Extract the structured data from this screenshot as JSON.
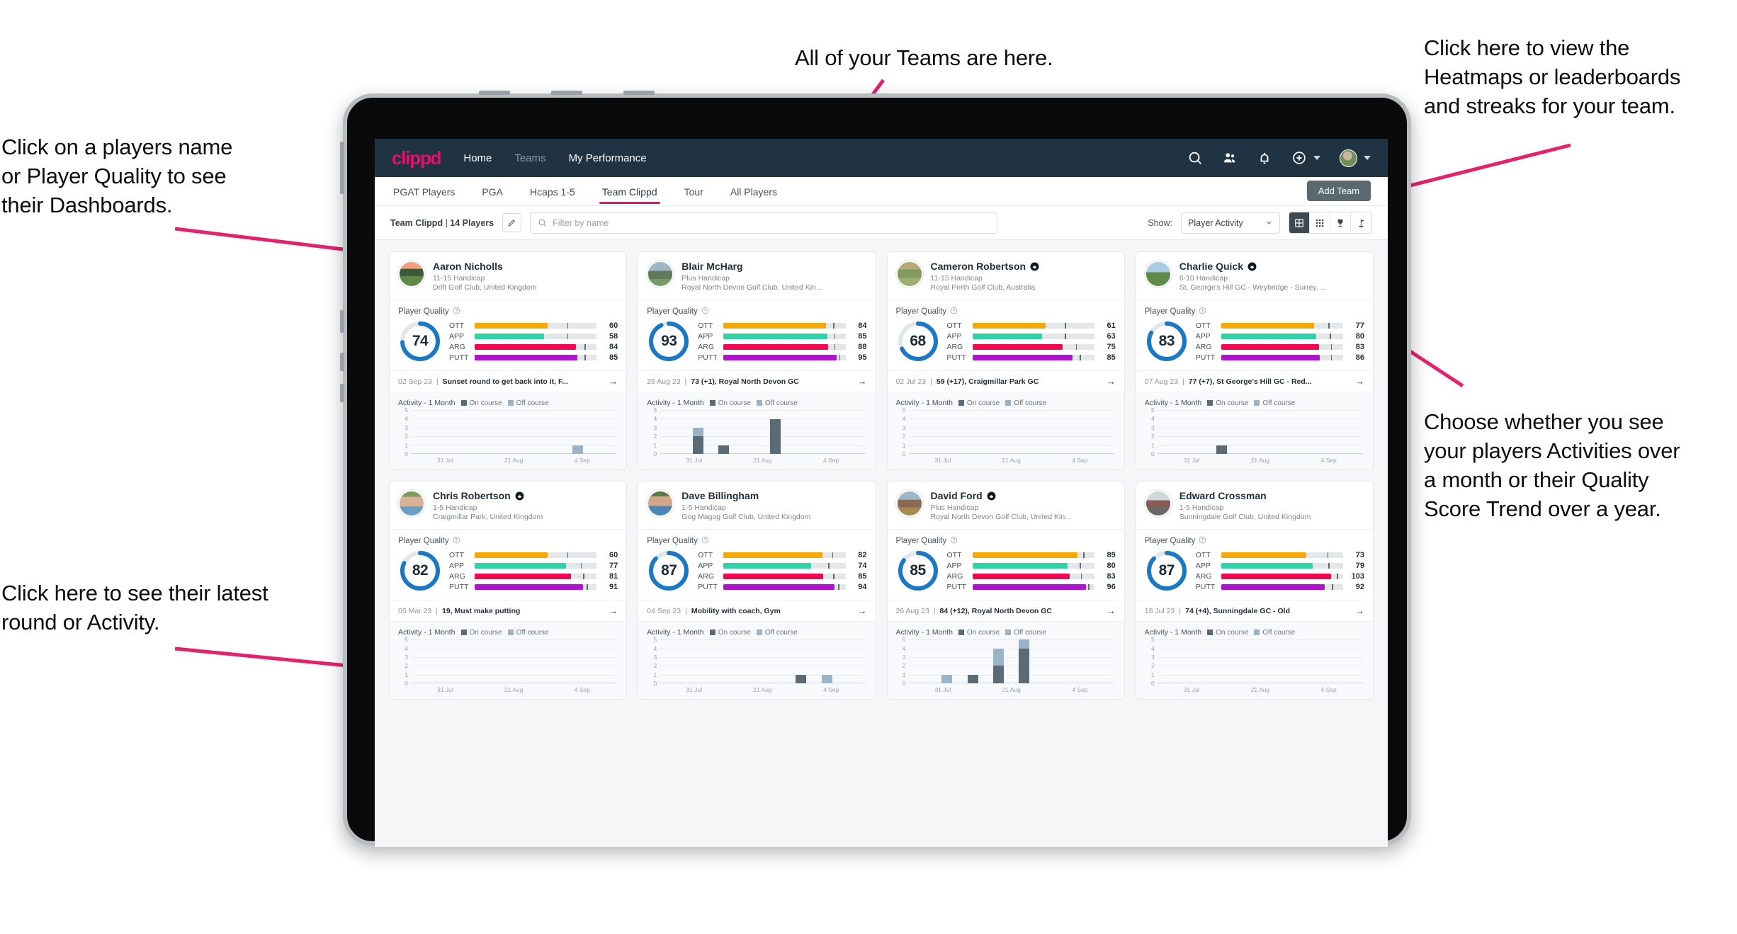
{
  "annotations": [
    {
      "id": "players-name",
      "text": "Click on a players name\nor Player Quality to see\ntheir Dashboards."
    },
    {
      "id": "teams-here",
      "text": "All of your Teams are here."
    },
    {
      "id": "heatmaps",
      "text": "Click here to view the\nHeatmaps or leaderboards\nand streaks for your team."
    },
    {
      "id": "activity-toggle",
      "text": "Choose whether you see\nyour players Activities over\na month or their Quality\nScore Trend over a year."
    },
    {
      "id": "latest-round",
      "text": "Click here to see their latest\nround or Activity."
    }
  ],
  "app": {
    "logo": "clippd",
    "nav": [
      {
        "label": "Home",
        "active": true
      },
      {
        "label": "Teams",
        "active": false
      },
      {
        "label": "My Performance",
        "active": false
      }
    ],
    "icons": [
      "search-icon",
      "people-icon",
      "bell-icon",
      "plus-circle-icon",
      "avatar"
    ],
    "tabs": [
      {
        "label": "PGAT Players",
        "active": false
      },
      {
        "label": "PGA",
        "active": false
      },
      {
        "label": "Hcaps 1-5",
        "active": false
      },
      {
        "label": "Team Clippd",
        "active": true
      },
      {
        "label": "Tour",
        "active": false
      },
      {
        "label": "All Players",
        "active": false
      }
    ],
    "add_team_label": "Add Team",
    "filter": {
      "team_name": "Team Clippd",
      "team_count": "14 Players",
      "separator": " | ",
      "search_placeholder": "Filter by name",
      "search_value": "",
      "show_label": "Show:",
      "show_value": "Player Activity",
      "show_options": [
        "Player Activity",
        "Quality Score Trend"
      ],
      "view_buttons": [
        {
          "name": "grid-view-icon",
          "active": true
        },
        {
          "name": "dense-grid-view-icon",
          "active": false
        },
        {
          "name": "trophy-leaderboard-icon",
          "active": false
        },
        {
          "name": "flag-heatmap-icon",
          "active": false
        }
      ]
    }
  },
  "card_labels": {
    "player_quality": "Player Quality",
    "activity_title": "Activity - 1 Month",
    "legend_on": "On course",
    "legend_off": "Off course",
    "x_labels": [
      "31 Jul",
      "21 Aug",
      "4 Sep"
    ],
    "y_labels": [
      "5",
      "4",
      "3",
      "2",
      "1",
      "0"
    ]
  },
  "colors": {
    "brand_pink": "#ec0d6e",
    "header_navy": "#1f3342",
    "ring_blue": "#1a79c6",
    "ott": "#f5a800",
    "app": "#2ed4a8",
    "arg": "#f5054f",
    "putt": "#b112cf",
    "on_course": "#5b6b76",
    "off_course": "#9bb3c6",
    "annotation_arrow": "#e6206b"
  },
  "players": [
    {
      "name": "Aaron Nicholls",
      "verified": false,
      "handicap": "11-15 Handicap",
      "club": "Drift Golf Club, United Kingdom",
      "avatar_css": "linear-gradient(180deg,#f2a07a 0 28%,#3a5a3a 29% 58%,#5e8a46 59% 100%)",
      "quality": 74,
      "metrics": [
        {
          "label": "OTT",
          "value": 60,
          "fill_pct": 60,
          "tick_pct": 76
        },
        {
          "label": "APP",
          "value": 58,
          "fill_pct": 57,
          "tick_pct": 76
        },
        {
          "label": "ARG",
          "value": 84,
          "fill_pct": 83,
          "tick_pct": 90
        },
        {
          "label": "PUTT",
          "value": 85,
          "fill_pct": 84,
          "tick_pct": 90
        }
      ],
      "latest_date": "02 Sep 23",
      "latest_text": "Sunset round to get back into it, F...",
      "activity": [
        {
          "on": 0,
          "off": 0
        },
        {
          "on": 0,
          "off": 0
        },
        {
          "on": 0,
          "off": 0
        },
        {
          "on": 0,
          "off": 0
        },
        {
          "on": 0,
          "off": 0
        },
        {
          "on": 0,
          "off": 0
        },
        {
          "on": 0,
          "off": 1
        },
        {
          "on": 0,
          "off": 0
        }
      ]
    },
    {
      "name": "Blair McHarg",
      "verified": false,
      "handicap": "Plus Handicap",
      "club": "Royal North Devon Golf Club, United Kin...",
      "avatar_css": "linear-gradient(180deg,#9fb6c4 0 36%,#5d7a5a 37% 70%,#7a9a6a 71% 100%)",
      "quality": 93,
      "metrics": [
        {
          "label": "OTT",
          "value": 84,
          "fill_pct": 84,
          "tick_pct": 90
        },
        {
          "label": "APP",
          "value": 85,
          "fill_pct": 85,
          "tick_pct": 91
        },
        {
          "label": "ARG",
          "value": 88,
          "fill_pct": 86,
          "tick_pct": 91
        },
        {
          "label": "PUTT",
          "value": 95,
          "fill_pct": 93,
          "tick_pct": 95
        }
      ],
      "latest_date": "26 Aug 23",
      "latest_text": "73 (+1), Royal North Devon GC",
      "activity": [
        {
          "on": 0,
          "off": 0
        },
        {
          "on": 2,
          "off": 1
        },
        {
          "on": 1,
          "off": 0
        },
        {
          "on": 0,
          "off": 0
        },
        {
          "on": 4,
          "off": 0
        },
        {
          "on": 0,
          "off": 0
        },
        {
          "on": 0,
          "off": 0
        },
        {
          "on": 0,
          "off": 0
        }
      ]
    },
    {
      "name": "Cameron Robertson",
      "verified": true,
      "handicap": "11-15 Handicap",
      "club": "Royal Perth Golf Club, Australia",
      "avatar_css": "linear-gradient(180deg,#b9a878 0 30%,#7f9a5c 31% 64%,#9cae74 65% 100%)",
      "quality": 68,
      "metrics": [
        {
          "label": "OTT",
          "value": 61,
          "fill_pct": 60,
          "tick_pct": 76
        },
        {
          "label": "APP",
          "value": 63,
          "fill_pct": 57,
          "tick_pct": 76
        },
        {
          "label": "ARG",
          "value": 75,
          "fill_pct": 74,
          "tick_pct": 85
        },
        {
          "label": "PUTT",
          "value": 85,
          "fill_pct": 82,
          "tick_pct": 88
        }
      ],
      "latest_date": "02 Jul 23",
      "latest_text": "59 (+17), Craigmillar Park GC",
      "activity": [
        {
          "on": 0,
          "off": 0
        },
        {
          "on": 0,
          "off": 0
        },
        {
          "on": 0,
          "off": 0
        },
        {
          "on": 0,
          "off": 0
        },
        {
          "on": 0,
          "off": 0
        },
        {
          "on": 0,
          "off": 0
        },
        {
          "on": 0,
          "off": 0
        },
        {
          "on": 0,
          "off": 0
        }
      ]
    },
    {
      "name": "Charlie Quick",
      "verified": true,
      "handicap": "6-10 Handicap",
      "club": "St. George's Hill GC - Weybridge - Surrey, ...",
      "avatar_css": "linear-gradient(180deg,#a9cbe3 0 42%,#5e8a46 43% 100%)",
      "quality": 83,
      "metrics": [
        {
          "label": "OTT",
          "value": 77,
          "fill_pct": 76,
          "tick_pct": 88
        },
        {
          "label": "APP",
          "value": 80,
          "fill_pct": 78,
          "tick_pct": 89
        },
        {
          "label": "ARG",
          "value": 83,
          "fill_pct": 80,
          "tick_pct": 90
        },
        {
          "label": "PUTT",
          "value": 86,
          "fill_pct": 81,
          "tick_pct": 90
        }
      ],
      "latest_date": "07 Aug 23",
      "latest_text": "77 (+7), St George's Hill GC - Red...",
      "activity": [
        {
          "on": 0,
          "off": 0
        },
        {
          "on": 0,
          "off": 0
        },
        {
          "on": 1,
          "off": 0
        },
        {
          "on": 0,
          "off": 0
        },
        {
          "on": 0,
          "off": 0
        },
        {
          "on": 0,
          "off": 0
        },
        {
          "on": 0,
          "off": 0
        },
        {
          "on": 0,
          "off": 0
        }
      ]
    },
    {
      "name": "Chris Robertson",
      "verified": true,
      "handicap": "1-5 Handicap",
      "club": "Craigmillar Park, United Kingdom",
      "avatar_css": "linear-gradient(180deg,#7f9a5c 0 22%,#d8b295 23% 62%,#6aa0c8 63% 100%)",
      "quality": 82,
      "metrics": [
        {
          "label": "OTT",
          "value": 60,
          "fill_pct": 60,
          "tick_pct": 76
        },
        {
          "label": "APP",
          "value": 77,
          "fill_pct": 75,
          "tick_pct": 87
        },
        {
          "label": "ARG",
          "value": 81,
          "fill_pct": 79,
          "tick_pct": 89
        },
        {
          "label": "PUTT",
          "value": 91,
          "fill_pct": 89,
          "tick_pct": 92
        }
      ],
      "latest_date": "05 Mar 23",
      "latest_text": "19, Must make putting",
      "activity": [
        {
          "on": 0,
          "off": 0
        },
        {
          "on": 0,
          "off": 0
        },
        {
          "on": 0,
          "off": 0
        },
        {
          "on": 0,
          "off": 0
        },
        {
          "on": 0,
          "off": 0
        },
        {
          "on": 0,
          "off": 0
        },
        {
          "on": 0,
          "off": 0
        },
        {
          "on": 0,
          "off": 0
        }
      ]
    },
    {
      "name": "Dave Billingham",
      "verified": false,
      "handicap": "1-5 Handicap",
      "club": "Gog Magog Golf Club, United Kingdom",
      "avatar_css": "linear-gradient(180deg,#5e7a4a 0 20%,#d2a686 21% 60%,#4b84b5 61% 100%)",
      "quality": 87,
      "metrics": [
        {
          "label": "OTT",
          "value": 82,
          "fill_pct": 81,
          "tick_pct": 89
        },
        {
          "label": "APP",
          "value": 74,
          "fill_pct": 72,
          "tick_pct": 86
        },
        {
          "label": "ARG",
          "value": 85,
          "fill_pct": 82,
          "tick_pct": 90
        },
        {
          "label": "PUTT",
          "value": 94,
          "fill_pct": 91,
          "tick_pct": 94
        }
      ],
      "latest_date": "04 Sep 23",
      "latest_text": "Mobility with coach, Gym",
      "activity": [
        {
          "on": 0,
          "off": 0
        },
        {
          "on": 0,
          "off": 0
        },
        {
          "on": 0,
          "off": 0
        },
        {
          "on": 0,
          "off": 0
        },
        {
          "on": 0,
          "off": 0
        },
        {
          "on": 1,
          "off": 0
        },
        {
          "on": 0,
          "off": 1
        },
        {
          "on": 0,
          "off": 0
        }
      ]
    },
    {
      "name": "David Ford",
      "verified": true,
      "handicap": "Plus Handicap",
      "club": "Royal North Devon Golf Club, United Kin...",
      "avatar_css": "linear-gradient(180deg,#9db7c9 0 34%,#8a6a52 35% 66%,#a8894f 67% 100%)",
      "quality": 85,
      "metrics": [
        {
          "label": "OTT",
          "value": 89,
          "fill_pct": 86,
          "tick_pct": 91
        },
        {
          "label": "APP",
          "value": 80,
          "fill_pct": 78,
          "tick_pct": 88
        },
        {
          "label": "ARG",
          "value": 83,
          "fill_pct": 80,
          "tick_pct": 89
        },
        {
          "label": "PUTT",
          "value": 96,
          "fill_pct": 93,
          "tick_pct": 95
        }
      ],
      "latest_date": "26 Aug 23",
      "latest_text": "84 (+12), Royal North Devon GC",
      "activity": [
        {
          "on": 0,
          "off": 0
        },
        {
          "on": 0,
          "off": 1
        },
        {
          "on": 1,
          "off": 0
        },
        {
          "on": 2,
          "off": 2
        },
        {
          "on": 4,
          "off": 1
        },
        {
          "on": 0,
          "off": 0
        },
        {
          "on": 0,
          "off": 0
        },
        {
          "on": 0,
          "off": 0
        }
      ]
    },
    {
      "name": "Edward Crossman",
      "verified": false,
      "handicap": "1-5 Handicap",
      "club": "Sunningdale Golf Club, United Kingdom",
      "avatar_css": "linear-gradient(180deg,#cfd6da 0 36%,#8c5a55 37% 64%,#6a6a6a 65% 100%)",
      "quality": 87,
      "metrics": [
        {
          "label": "OTT",
          "value": 73,
          "fill_pct": 70,
          "tick_pct": 87
        },
        {
          "label": "APP",
          "value": 79,
          "fill_pct": 75,
          "tick_pct": 88
        },
        {
          "label": "ARG",
          "value": 103,
          "fill_pct": 90,
          "tick_pct": 95
        },
        {
          "label": "PUTT",
          "value": 92,
          "fill_pct": 85,
          "tick_pct": 91
        }
      ],
      "latest_date": "18 Jul 23",
      "latest_text": "74 (+4), Sunningdale GC - Old",
      "activity": [
        {
          "on": 0,
          "off": 0
        },
        {
          "on": 0,
          "off": 0
        },
        {
          "on": 0,
          "off": 0
        },
        {
          "on": 0,
          "off": 0
        },
        {
          "on": 0,
          "off": 0
        },
        {
          "on": 0,
          "off": 0
        },
        {
          "on": 0,
          "off": 0
        },
        {
          "on": 0,
          "off": 0
        }
      ]
    }
  ]
}
